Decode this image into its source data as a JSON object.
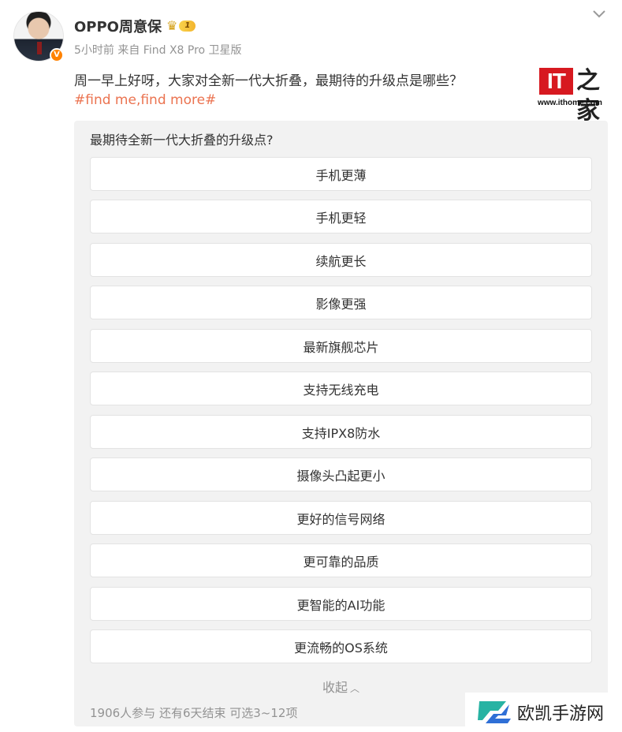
{
  "post": {
    "username": "OPPO周意保",
    "level_badge": "1",
    "verified_mark": "V",
    "meta": "5小时前  来自 Find X8 Pro 卫星版",
    "text": "周一早上好呀，大家对全新一代大折叠，最期待的升级点是哪些？",
    "hashtag": "#find me,find more#",
    "icons": {
      "menu": "chevron-down-icon",
      "crown": "crown-icon"
    }
  },
  "logo": {
    "mark": "IT",
    "zhi": "之家",
    "url": "www.ithome.com"
  },
  "poll": {
    "title": "最期待全新一代大折叠的升级点?",
    "options": [
      "手机更薄",
      "手机更轻",
      "续航更长",
      "影像更强",
      "最新旗舰芯片",
      "支持无线充电",
      "支持IPX8防水",
      "摄像头凸起更小",
      "更好的信号网络",
      "更可靠的品质",
      "更智能的AI功能",
      "更流畅的OS系统"
    ],
    "collapse_label": "收起",
    "footer": "1906人参与  还有6天结束  可选3~12项"
  },
  "watermark": {
    "text": "欧凯手游网"
  },
  "colors": {
    "accent_orange": "#eb7350",
    "verified_orange": "#ff8200",
    "ithome_red": "#d71920",
    "muted_text": "#939393",
    "poll_bg": "#f2f2f2"
  }
}
